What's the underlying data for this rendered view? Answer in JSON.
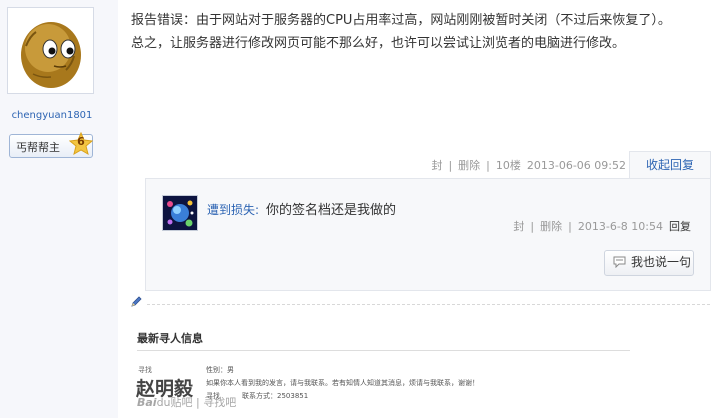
{
  "author": {
    "username": "chengyuan1801",
    "rank_label": "丐帮帮主",
    "level": "6"
  },
  "post": {
    "lines": [
      "报告错误：由于网站对于服务器的CPU占用率过高，网站刚刚被暂时关闭（不过后来恢复了）。",
      "总之，让服务器进行修改网页可能不那么好，也许可以尝试让浏览者的电脑进行修改。"
    ],
    "meta": {
      "seal": "封",
      "separator": "|",
      "delete": "删除",
      "floor": "10楼",
      "timestamp": "2013-06-06 09:52"
    },
    "collapse_reply": "收起回复"
  },
  "reply": {
    "username": "遭到损失",
    "colon": ":",
    "text": "你的签名档还是我做的",
    "meta": {
      "seal": "封",
      "separator": "|",
      "delete": "删除",
      "timestamp": "2013-6-8 10:54",
      "reply": "回复"
    },
    "say_button": "我也说一句"
  },
  "signature": {
    "title": "最新寻人信息",
    "find_label": "寻找",
    "name": "赵明毅",
    "gender": "性别：男",
    "description": "如果你本人看到我的发言，请与我联系。若有知情人知道其消息，烦请与我联系，谢谢！",
    "contact_prefix": "寻找",
    "contact": "联系方式：2503851",
    "watermark_brand": "Bai",
    "watermark_rest": "du贴吧 | 寻找吧"
  },
  "icons": {
    "avatar": "wallnut-avatar",
    "reply_avatar": "space-avatar",
    "level_badge": "star-badge-icon",
    "say_button": "chat-bubble-icon",
    "pencil": "pencil-icon"
  },
  "colors": {
    "link": "#2d64b3",
    "meta": "#999999",
    "panel": "#f7f8fa"
  }
}
